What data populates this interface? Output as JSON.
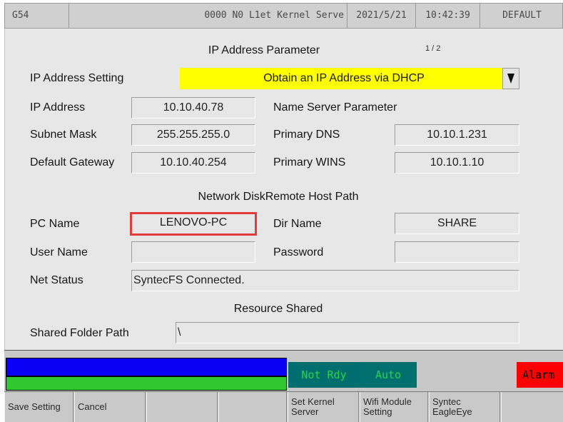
{
  "title_bar": {
    "coordinate": "G54",
    "message": "0000 N0 L1et Kernel Serve",
    "date": "2021/5/21",
    "time": "10:42:39",
    "mode": "DEFAULT"
  },
  "page": {
    "header": "IP Address Parameter",
    "indicator": "1 / 2"
  },
  "ip_setting": {
    "label": "IP Address Setting",
    "value": "Obtain an IP Address via DHCP",
    "dropdown_icon": "triangle-down-icon",
    "highlight_color": "#ffff00"
  },
  "left_fields": [
    {
      "label": "IP Address",
      "value": "10.10.40.78"
    },
    {
      "label": "Subnet Mask",
      "value": "255.255.255.0"
    },
    {
      "label": "Default Gateway",
      "value": "10.10.40.254"
    }
  ],
  "name_server": {
    "header": "Name Server Parameter",
    "primary_dns_label": "Primary DNS",
    "primary_dns_value": "10.10.1.231",
    "primary_wins_label": "Primary WINS",
    "primary_wins_value": "10.10.1.10"
  },
  "network_disk": {
    "header": "Network DiskRemote Host Path",
    "pc_name_label": "PC Name",
    "pc_name_value": "LENOVO-PC",
    "dir_name_label": "Dir Name",
    "dir_name_value": "SHARE",
    "user_name_label": "User Name",
    "user_name_value": "",
    "password_label": "Password",
    "password_value": "",
    "net_status_label": "Net Status",
    "net_status_value": "SyntecFS Connected."
  },
  "resource_shared": {
    "header": "Resource Shared",
    "shared_folder_label": "Shared Folder Path",
    "shared_folder_value": "\\"
  },
  "status": {
    "not_ready": "Not Rdy",
    "auto": "Auto",
    "alarm": "Alarm",
    "colors": {
      "ready_bg": "#006e6e",
      "ready_text": "#2cd24a",
      "alarm_bg": "#ff0000",
      "alarm_text": "#000000",
      "bar_blue": "#0a00f5",
      "bar_green": "#2fc92f",
      "selected_border": "#e23b3b"
    }
  },
  "function_keys": [
    {
      "label": "Save Setting"
    },
    {
      "label": "Cancel"
    },
    {
      "label": ""
    },
    {
      "label": ""
    },
    {
      "label": "Set Kernel Server"
    },
    {
      "label": "Wifi Module Setting"
    },
    {
      "label": "Syntec EagleEye"
    },
    {
      "label": ""
    }
  ]
}
